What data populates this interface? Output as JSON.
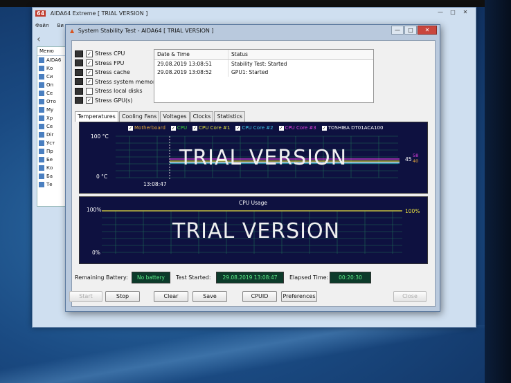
{
  "main_window": {
    "title": "AIDA64 Extreme  [ TRIAL VERSION ]",
    "logo": "64",
    "menu": [
      "Файл",
      "Ви"
    ],
    "sidebar_tab": "Меню",
    "sidebar_items": [
      "AIDA6",
      "Ко",
      "Си",
      "Оп",
      "Се",
      "Ото",
      "Му",
      "Хр",
      "Се",
      "Dir",
      "Уст",
      "Пр",
      "Бе",
      "Ко",
      "Ба",
      "Те"
    ]
  },
  "dialog": {
    "title": "System Stability Test - AIDA64  [ TRIAL VERSION ]",
    "controls": {
      "minimize": "—",
      "maximize": "□",
      "close": "✕"
    },
    "stress_options": [
      {
        "label": "Stress CPU",
        "checked": true,
        "icon": "cpu-icon"
      },
      {
        "label": "Stress FPU",
        "checked": true,
        "icon": "fpu-icon"
      },
      {
        "label": "Stress cache",
        "checked": true,
        "icon": "cache-icon"
      },
      {
        "label": "Stress system memory",
        "checked": true,
        "icon": "memory-icon"
      },
      {
        "label": "Stress local disks",
        "checked": false,
        "icon": "disk-icon"
      },
      {
        "label": "Stress GPU(s)",
        "checked": true,
        "icon": "gpu-icon"
      }
    ],
    "log": {
      "headers": {
        "datetime": "Date & Time",
        "status": "Status"
      },
      "rows": [
        {
          "datetime": "29.08.2019 13:08:51",
          "status": "Stability Test: Started"
        },
        {
          "datetime": "29.08.2019 13:08:52",
          "status": "GPU1: Started"
        }
      ]
    },
    "tabs": [
      "Temperatures",
      "Cooling Fans",
      "Voltages",
      "Clocks",
      "Statistics"
    ],
    "active_tab": "Temperatures",
    "temp_graph": {
      "legend": [
        {
          "label": "Motherboard",
          "color": "#e8a838"
        },
        {
          "label": "CPU",
          "color": "#3cdc3c"
        },
        {
          "label": "CPU Core #1",
          "color": "#e0e040"
        },
        {
          "label": "CPU Core #2",
          "color": "#40c8e8"
        },
        {
          "label": "CPU Core #3",
          "color": "#e040e0"
        },
        {
          "label": "TOSHIBA DT01ACA100",
          "color": "#ffffff"
        }
      ],
      "y_max": "100 °C",
      "y_min": "0 °C",
      "time": "13:08:47",
      "values": {
        "v1": "45",
        "v2": "58",
        "v3": "40"
      },
      "watermark": "TRIAL VERSION"
    },
    "cpu_graph": {
      "title": "CPU Usage",
      "y_max": "100%",
      "y_min": "0%",
      "value": "100%",
      "watermark": "TRIAL VERSION"
    },
    "status": {
      "battery_label": "Remaining Battery:",
      "battery_value": "No battery",
      "started_label": "Test Started:",
      "started_value": "29.08.2019 13:08:47",
      "elapsed_label": "Elapsed Time:",
      "elapsed_value": "00:20:30"
    },
    "buttons": {
      "start": "Start",
      "stop": "Stop",
      "clear": "Clear",
      "save": "Save",
      "cpuid": "CPUID",
      "preferences": "Preferences",
      "close": "Close"
    }
  }
}
